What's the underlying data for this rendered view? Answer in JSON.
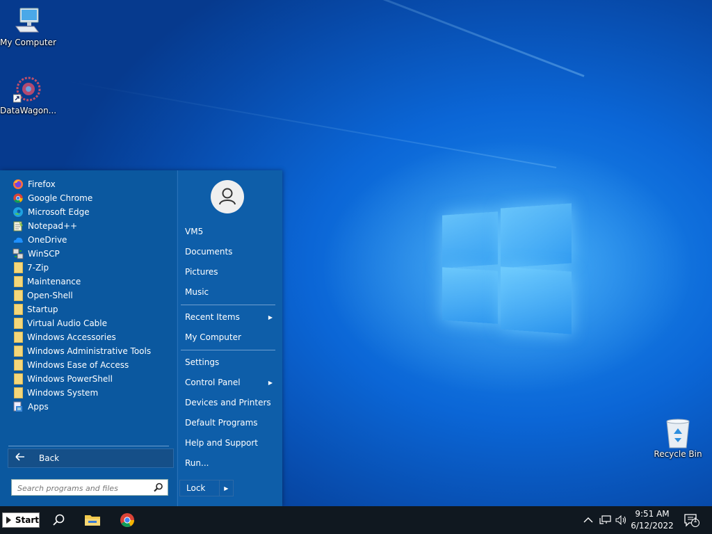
{
  "desktop": {
    "icons": [
      {
        "label": "My Computer"
      },
      {
        "label": "DataWagon..."
      },
      {
        "label": "Recycle Bin"
      }
    ]
  },
  "startmenu": {
    "programs": [
      {
        "label": "Firefox",
        "icon": "firefox-icon"
      },
      {
        "label": "Google Chrome",
        "icon": "chrome-icon"
      },
      {
        "label": "Microsoft Edge",
        "icon": "edge-icon"
      },
      {
        "label": "Notepad++",
        "icon": "notepad-plus-plus-icon"
      },
      {
        "label": "OneDrive",
        "icon": "onedrive-icon"
      },
      {
        "label": "WinSCP",
        "icon": "winscp-icon"
      },
      {
        "label": "7-Zip",
        "icon": "folder-icon"
      },
      {
        "label": "Maintenance",
        "icon": "folder-icon"
      },
      {
        "label": "Open-Shell",
        "icon": "folder-icon"
      },
      {
        "label": "Startup",
        "icon": "folder-icon"
      },
      {
        "label": "Virtual Audio Cable",
        "icon": "folder-icon"
      },
      {
        "label": "Windows Accessories",
        "icon": "folder-icon"
      },
      {
        "label": "Windows Administrative Tools",
        "icon": "folder-icon"
      },
      {
        "label": "Windows Ease of Access",
        "icon": "folder-icon"
      },
      {
        "label": "Windows PowerShell",
        "icon": "folder-icon"
      },
      {
        "label": "Windows System",
        "icon": "folder-icon"
      },
      {
        "label": "Apps",
        "icon": "apps-icon"
      }
    ],
    "back_label": "Back",
    "search_placeholder": "Search programs and files",
    "right": {
      "user": "VM5",
      "documents": "Documents",
      "pictures": "Pictures",
      "music": "Music",
      "recent_items": "Recent Items",
      "my_computer": "My Computer",
      "settings": "Settings",
      "control_panel": "Control Panel",
      "devices_printers": "Devices and Printers",
      "default_programs": "Default Programs",
      "help_support": "Help and Support",
      "run": "Run...",
      "lock": "Lock"
    }
  },
  "taskbar": {
    "start_label": "Start",
    "time": "9:51 AM",
    "date": "6/12/2022",
    "notification_count": "1"
  },
  "colors": {
    "menu_bg": "#0b589f",
    "taskbar_bg": "#101820",
    "accent": "#0f5ca6"
  }
}
